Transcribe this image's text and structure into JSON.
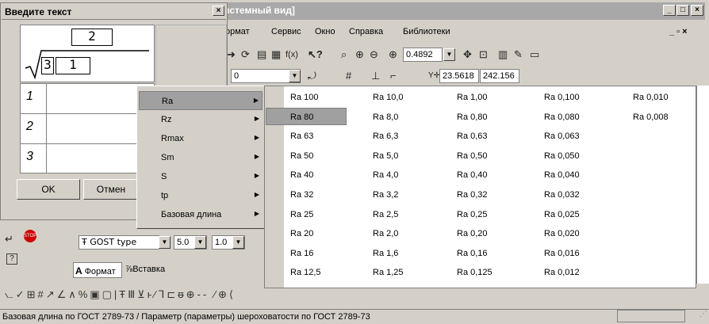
{
  "window": {
    "title": "истемный вид]",
    "controls": [
      "_",
      "□",
      "×"
    ],
    "mdi_controls": "_ ▫ ×"
  },
  "menubar": {
    "items": [
      "ормат",
      "Сервис",
      "Окно",
      "Справка",
      "Библиотеки"
    ]
  },
  "toolbar": {
    "zoom": "0.4892",
    "layer_value": "0",
    "coord_y": "23.5618",
    "coord_x": "242.156"
  },
  "dialog": {
    "title": "Введите текст",
    "fraction_top": "2",
    "fraction_index": "3",
    "fraction_value": "1",
    "rows": [
      "1",
      "2",
      "3"
    ],
    "ok_label": "OK",
    "cancel_label": "Отмен"
  },
  "submenu": {
    "items": [
      "Ra",
      "Rz",
      "Rmax",
      "Sm",
      "S",
      "tp",
      "Базовая длина"
    ]
  },
  "values": {
    "col1": [
      "Ra 100",
      "Ra 80",
      "Ra 63",
      "Ra 50",
      "Ra 40",
      "Ra 32",
      "Ra 25",
      "Ra 20",
      "Ra 16",
      "Ra 12,5"
    ],
    "col2": [
      "Ra 10,0",
      "Ra 8,0",
      "Ra 6,3",
      "Ra 5,0",
      "Ra 4,0",
      "Ra 3,2",
      "Ra 2,5",
      "Ra 2,0",
      "Ra 1,6",
      "Ra 1,25"
    ],
    "col3": [
      "Ra 1,00",
      "Ra 0,80",
      "Ra 0,63",
      "Ra 0,50",
      "Ra 0,40",
      "Ra 0,32",
      "Ra 0,25",
      "Ra 0,20",
      "Ra 0,16",
      "Ra 0,125"
    ],
    "col4": [
      "Ra 0,100",
      "Ra 0,080",
      "Ra 0,063",
      "Ra 0,050",
      "Ra 0,040",
      "Ra 0,032",
      "Ra 0,025",
      "Ra 0,020",
      "Ra 0,016",
      "Ra 0,012"
    ],
    "col5": [
      "Ra 0,010",
      "Ra 0,008"
    ],
    "selected": "Ra 80"
  },
  "format_panel": {
    "font": "GOST type",
    "size": "5.0",
    "scale": "1.0",
    "tab_format": "Формат",
    "tab_insert": "Вставка"
  },
  "status": {
    "text": "Базовая длина по ГОСТ 2789-73 / Параметр (параметры) шероховатости по ГОСТ 2789-73"
  },
  "colors": {
    "face": "#d4d0c8",
    "selection": "#a0a0a0"
  }
}
